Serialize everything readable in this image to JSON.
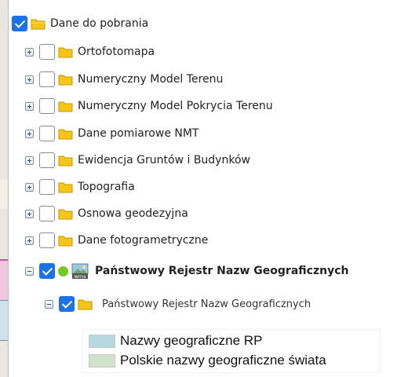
{
  "layers": {
    "root": {
      "label": "Dane do pobrania",
      "checked": true
    },
    "groups": [
      {
        "label": "Ortofotomapa"
      },
      {
        "label": "Numeryczny Model Terenu"
      },
      {
        "label": "Numeryczny Model Pokrycia Terenu"
      },
      {
        "label": "Dane pomiarowe NMT"
      },
      {
        "label": "Ewidencja Gruntów i Budynków"
      },
      {
        "label": "Topografia"
      },
      {
        "label": "Osnowa geodezyjna"
      },
      {
        "label": "Dane fotogrametryczne"
      }
    ],
    "service": {
      "label": "Państwowy Rejestr Nazw Geograficznych",
      "icon_text": "wms",
      "status_color": "#73c91e"
    },
    "sublayer": {
      "label": "Państwowy Rejestr Nazw Geograficznych"
    }
  },
  "legend": [
    {
      "label": "Nazwy geograficzne RP",
      "color": "#b6d8e0"
    },
    {
      "label": "Polskie nazwy geograficzne świata",
      "color": "#cfe3c9"
    }
  ],
  "colors": {
    "checkbox_checked": "#1a73e8",
    "folder": "#f5c518"
  }
}
